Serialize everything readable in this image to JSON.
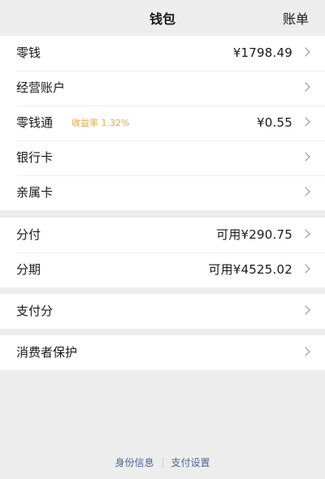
{
  "header": {
    "title": "钱包",
    "bill_label": "账单"
  },
  "groups": [
    {
      "rows": [
        {
          "label": "零钱",
          "value": "¥1798.49"
        },
        {
          "label": "经营账户",
          "value": ""
        },
        {
          "label": "零钱通",
          "badge": "收益率 1.32%",
          "value": "¥0.55"
        },
        {
          "label": "银行卡",
          "value": ""
        },
        {
          "label": "亲属卡",
          "value": ""
        }
      ]
    },
    {
      "rows": [
        {
          "label": "分付",
          "value": "可用¥290.75"
        },
        {
          "label": "分期",
          "value": "可用¥4525.02"
        }
      ]
    },
    {
      "rows": [
        {
          "label": "支付分",
          "value": ""
        }
      ]
    },
    {
      "rows": [
        {
          "label": "消费者保护",
          "value": ""
        }
      ]
    }
  ],
  "footer": {
    "identity_link": "身份信息",
    "settings_link": "支付设置"
  },
  "colors": {
    "background": "#ededed",
    "card": "#ffffff",
    "badge": "#e2a84a",
    "link": "#4a6592"
  },
  "icons": {
    "row_arrow": "chevron-right-icon"
  }
}
